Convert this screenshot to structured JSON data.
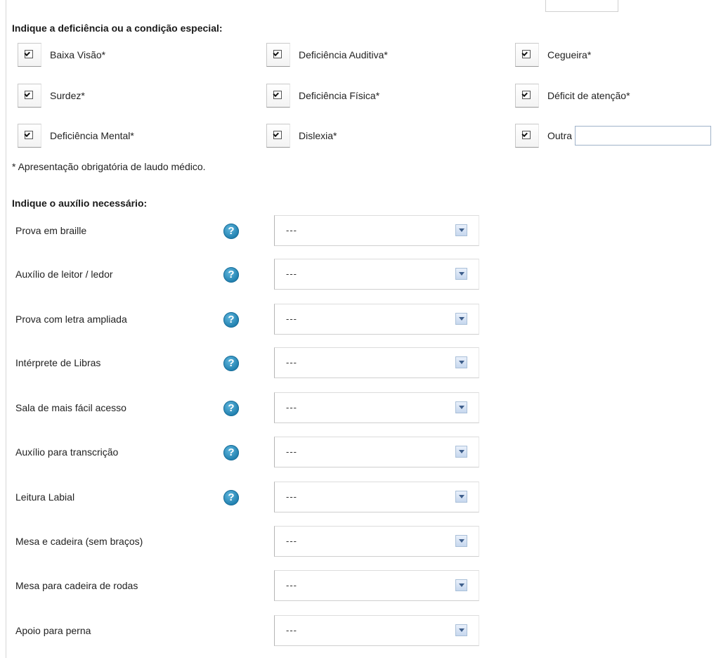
{
  "deficiency_section": {
    "title": "Indique a deficiência ou a condição especial:",
    "items": [
      {
        "label": "Baixa Visão*",
        "checked": true
      },
      {
        "label": "Deficiência Auditiva*",
        "checked": true
      },
      {
        "label": "Cegueira*",
        "checked": true
      },
      {
        "label": "Surdez*",
        "checked": true
      },
      {
        "label": "Deficiência Física*",
        "checked": true
      },
      {
        "label": "Déficit de atenção*",
        "checked": true
      },
      {
        "label": "Deficiência Mental*",
        "checked": true
      },
      {
        "label": "Dislexia*",
        "checked": true
      },
      {
        "label": "Outra",
        "checked": true
      }
    ],
    "other_value": "",
    "note": "* Apresentação obrigatória de laudo médico."
  },
  "aid_section": {
    "title": "Indique o auxílio necessário:",
    "rows": [
      {
        "label": "Prova em braille",
        "help": true,
        "selected": "---"
      },
      {
        "label": "Auxílio de leitor / ledor",
        "help": true,
        "selected": "---"
      },
      {
        "label": "Prova com letra ampliada",
        "help": true,
        "selected": "---"
      },
      {
        "label": "Intérprete de Libras",
        "help": true,
        "selected": "---"
      },
      {
        "label": "Sala de mais fácil acesso",
        "help": true,
        "selected": "---"
      },
      {
        "label": "Auxílio para transcrição",
        "help": true,
        "selected": "---"
      },
      {
        "label": "Leitura Labial",
        "help": true,
        "selected": "---"
      },
      {
        "label": "Mesa e cadeira (sem braços)",
        "help": false,
        "selected": "---"
      },
      {
        "label": "Mesa para cadeira de rodas",
        "help": false,
        "selected": "---"
      },
      {
        "label": "Apoio para perna",
        "help": false,
        "selected": "---"
      }
    ],
    "help_glyph": "?"
  },
  "icons": {
    "help": "help-question-icon",
    "dropdown": "chevron-down-icon",
    "checkbox": "checkbox-checked-icon"
  },
  "colors": {
    "help_icon": "#1f7fae",
    "dropdown_arrow_bg": "#c6d7ee",
    "input_border": "#9fb2c9"
  }
}
